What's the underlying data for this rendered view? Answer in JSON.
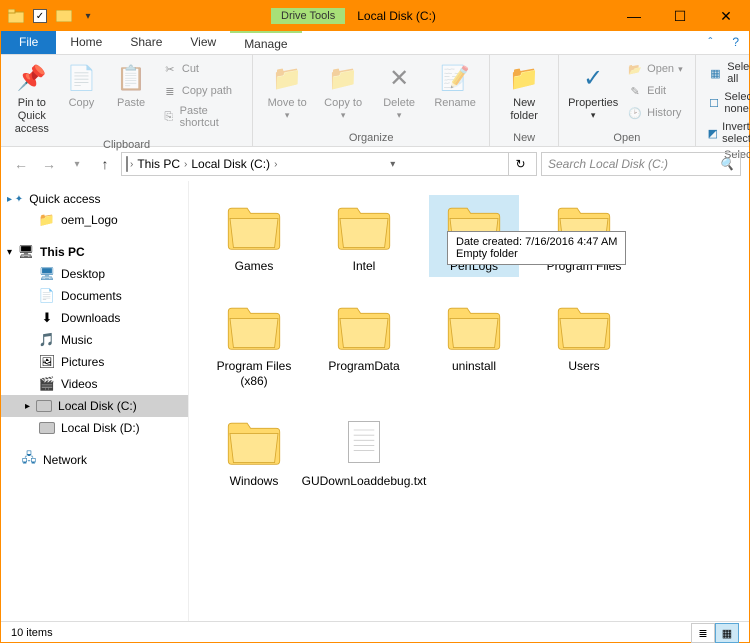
{
  "window": {
    "title": "Local Disk (C:)",
    "drivetools": "Drive Tools"
  },
  "tabs": {
    "file": "File",
    "home": "Home",
    "share": "Share",
    "view": "View",
    "manage": "Manage"
  },
  "ribbon": {
    "pin": "Pin to Quick access",
    "copy": "Copy",
    "paste": "Paste",
    "cut": "Cut",
    "copypath": "Copy path",
    "pasteshortcut": "Paste shortcut",
    "clipboard": "Clipboard",
    "moveto": "Move to",
    "copyto": "Copy to",
    "delete": "Delete",
    "rename": "Rename",
    "organize": "Organize",
    "newfolder": "New folder",
    "new": "New",
    "properties": "Properties",
    "open_btn": "Open",
    "edit": "Edit",
    "history": "History",
    "open": "Open",
    "selectall": "Select all",
    "selectnone": "Select none",
    "invert": "Invert selection",
    "select": "Select"
  },
  "breadcrumb": {
    "thispc": "This PC",
    "localdisk": "Local Disk (C:)"
  },
  "search": {
    "placeholder": "Search Local Disk (C:)"
  },
  "nav": {
    "quick": "Quick access",
    "oem": "oem_Logo",
    "thispc": "This PC",
    "desktop": "Desktop",
    "documents": "Documents",
    "downloads": "Downloads",
    "music": "Music",
    "pictures": "Pictures",
    "videos": "Videos",
    "cdrive": "Local Disk (C:)",
    "ddrive": "Local Disk (D:)",
    "network": "Network"
  },
  "items": [
    {
      "name": "Games",
      "type": "folder"
    },
    {
      "name": "Intel",
      "type": "folder"
    },
    {
      "name": "PerfLogs",
      "type": "folder",
      "selected": true
    },
    {
      "name": "Program Files",
      "type": "folder"
    },
    {
      "name": "Program Files (x86)",
      "type": "folder"
    },
    {
      "name": "ProgramData",
      "type": "folder"
    },
    {
      "name": "uninstall",
      "type": "folder"
    },
    {
      "name": "Users",
      "type": "folder"
    },
    {
      "name": "Windows",
      "type": "folder"
    },
    {
      "name": "GUDownLoaddebug.txt",
      "type": "file"
    }
  ],
  "tooltip": {
    "line1": "Date created: 7/16/2016 4:47 AM",
    "line2": "Empty folder"
  },
  "status": {
    "count": "10 items"
  }
}
